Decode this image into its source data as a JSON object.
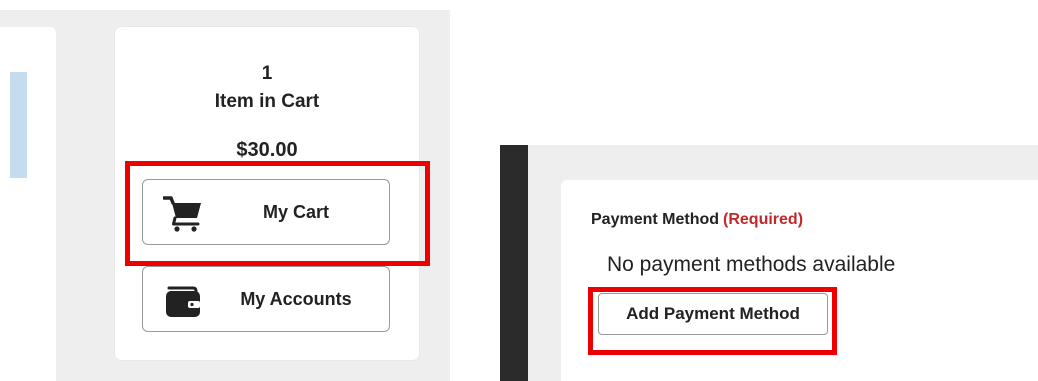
{
  "cart": {
    "count": "1",
    "label": "Item in Cart",
    "total": "$30.00",
    "my_cart_label": "My Cart",
    "my_accounts_label": "My Accounts"
  },
  "payment": {
    "heading": "Payment Method",
    "required": "(Required)",
    "empty_message": "No payment methods available",
    "add_button_label": "Add Payment Method"
  },
  "colors": {
    "highlight": "#ee0000",
    "required_text": "#c0282d",
    "panel_background": "#eeeeee",
    "dark_strip": "#2b2b2b",
    "accent_block": "#c5dcee"
  },
  "icons": {
    "cart_button_icon": "shopping-cart-icon",
    "accounts_button_icon": "wallet-icon"
  }
}
